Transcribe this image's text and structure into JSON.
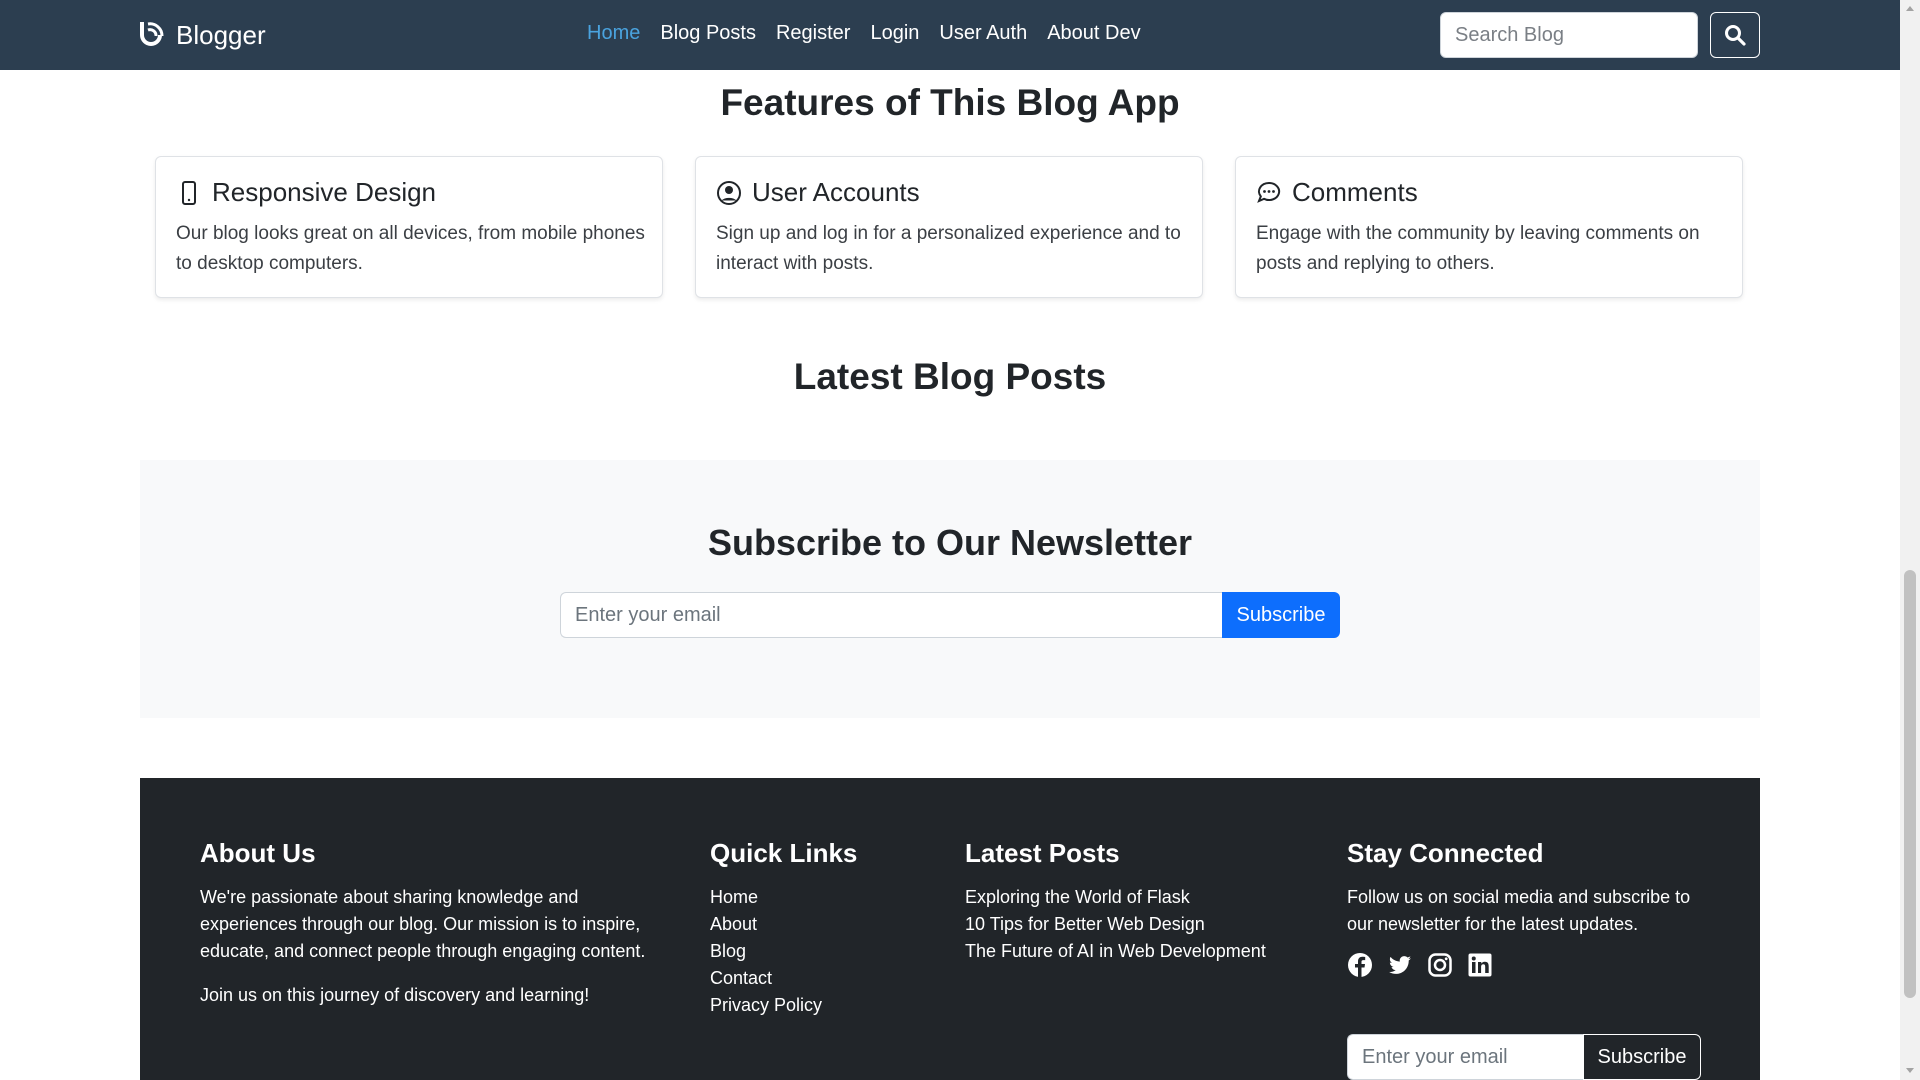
{
  "navbar": {
    "brand": "Blogger",
    "links": [
      {
        "label": "Home",
        "active": true
      },
      {
        "label": "Blog Posts"
      },
      {
        "label": "Register"
      },
      {
        "label": "Login"
      },
      {
        "label": "User Auth"
      },
      {
        "label": "About Dev"
      }
    ],
    "search_placeholder": "Search Blog",
    "colors": {
      "background": "#2c3e50",
      "active_link": "#4aa3df"
    }
  },
  "features": {
    "title": "Features of This Blog App",
    "cards": [
      {
        "icon": "phone-icon",
        "title": "Responsive Design",
        "description": "Our blog looks great on all devices, from mobile phones to desktop computers."
      },
      {
        "icon": "user-circle-icon",
        "title": "User Accounts",
        "description": "Sign up and log in for a personalized experience and to interact with posts."
      },
      {
        "icon": "chat-dots-icon",
        "title": "Comments",
        "description": "Engage with the community by leaving comments on posts and replying to others."
      }
    ]
  },
  "latest_posts_title": "Latest Blog Posts",
  "newsletter": {
    "title": "Subscribe to Our Newsletter",
    "placeholder": "Enter your email",
    "button": "Subscribe",
    "button_color": "#0d6efd"
  },
  "footer": {
    "background": "#212529",
    "about": {
      "title": "About Us",
      "text": "We're passionate about sharing knowledge and experiences through our blog. Our mission is to inspire, educate, and connect people through engaging content.",
      "text2": "Join us on this journey of discovery and learning!"
    },
    "quick_links": {
      "title": "Quick Links",
      "items": [
        "Home",
        "About",
        "Blog",
        "Contact",
        "Privacy Policy"
      ]
    },
    "latest_posts": {
      "title": "Latest Posts",
      "items": [
        "Exploring the World of Flask",
        "10 Tips for Better Web Design",
        "The Future of AI in Web Development"
      ]
    },
    "stay_connected": {
      "title": "Stay Connected",
      "text": "Follow us on social media and subscribe to our newsletter for the latest updates.",
      "social_icons": [
        "facebook-icon",
        "twitter-icon",
        "instagram-icon",
        "linkedin-icon"
      ],
      "placeholder": "Enter your email",
      "button": "Subscribe"
    }
  }
}
